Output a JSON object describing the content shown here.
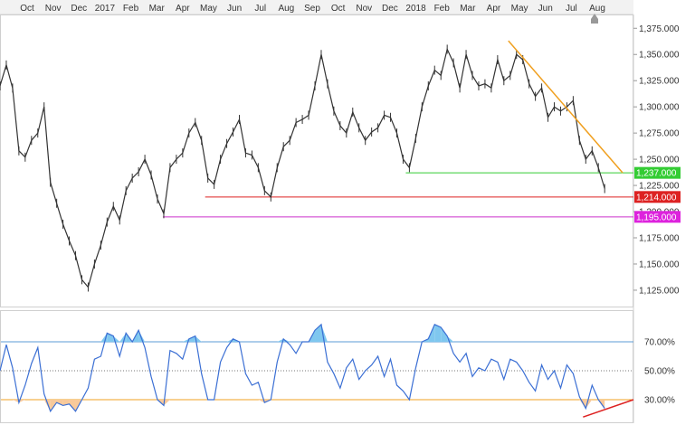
{
  "chart_data": [
    {
      "type": "line",
      "title": "",
      "xlabel": "",
      "ylabel": "",
      "x_ticks": [
        "Oct",
        "Nov",
        "Dec",
        "2017",
        "Feb",
        "Mar",
        "Apr",
        "May",
        "Jun",
        "Jul",
        "Aug",
        "Sep",
        "Oct",
        "Nov",
        "Dec",
        "2018",
        "Feb",
        "Mar",
        "Apr",
        "May",
        "Jun",
        "Jul",
        "Aug"
      ],
      "y_ticks": [
        "1,375.000",
        "1,350.000",
        "1,325.000",
        "1,300.000",
        "1,275.000",
        "1,250.000",
        "1,225.000",
        "1,200.000",
        "1,175.000",
        "1,150.000",
        "1,125.000"
      ],
      "y_tick_values": [
        1375,
        1350,
        1325,
        1300,
        1275,
        1250,
        1225,
        1200,
        1175,
        1150,
        1125
      ],
      "ylim": [
        1112,
        1383
      ],
      "grid": false,
      "x_range": [
        "2016-09-15",
        "2018-08-20"
      ],
      "series": [
        {
          "color": "#333333",
          "points": [
            [
              "2016-09-15",
              1320
            ],
            [
              "2016-09-22",
              1340
            ],
            [
              "2016-09-29",
              1318
            ],
            [
              "2016-10-06",
              1258
            ],
            [
              "2016-10-13",
              1252
            ],
            [
              "2016-10-20",
              1268
            ],
            [
              "2016-10-27",
              1275
            ],
            [
              "2016-11-03",
              1300
            ],
            [
              "2016-11-10",
              1228
            ],
            [
              "2016-11-17",
              1208
            ],
            [
              "2016-11-24",
              1188
            ],
            [
              "2016-12-01",
              1172
            ],
            [
              "2016-12-08",
              1158
            ],
            [
              "2016-12-15",
              1135
            ],
            [
              "2016-12-22",
              1128
            ],
            [
              "2016-12-29",
              1150
            ],
            [
              "2017-01-05",
              1168
            ],
            [
              "2017-01-12",
              1190
            ],
            [
              "2017-01-19",
              1205
            ],
            [
              "2017-01-26",
              1192
            ],
            [
              "2017-02-02",
              1220
            ],
            [
              "2017-02-09",
              1232
            ],
            [
              "2017-02-16",
              1238
            ],
            [
              "2017-02-23",
              1250
            ],
            [
              "2017-03-02",
              1235
            ],
            [
              "2017-03-09",
              1212
            ],
            [
              "2017-03-16",
              1198
            ],
            [
              "2017-03-23",
              1242
            ],
            [
              "2017-03-30",
              1250
            ],
            [
              "2017-04-06",
              1256
            ],
            [
              "2017-04-13",
              1275
            ],
            [
              "2017-04-20",
              1285
            ],
            [
              "2017-04-27",
              1268
            ],
            [
              "2017-05-04",
              1232
            ],
            [
              "2017-05-11",
              1226
            ],
            [
              "2017-05-18",
              1250
            ],
            [
              "2017-05-25",
              1265
            ],
            [
              "2017-06-01",
              1276
            ],
            [
              "2017-06-08",
              1288
            ],
            [
              "2017-06-15",
              1256
            ],
            [
              "2017-06-22",
              1254
            ],
            [
              "2017-06-29",
              1242
            ],
            [
              "2017-07-06",
              1220
            ],
            [
              "2017-07-13",
              1214
            ],
            [
              "2017-07-20",
              1242
            ],
            [
              "2017-07-27",
              1262
            ],
            [
              "2017-08-03",
              1268
            ],
            [
              "2017-08-10",
              1285
            ],
            [
              "2017-08-17",
              1288
            ],
            [
              "2017-08-24",
              1292
            ],
            [
              "2017-08-31",
              1320
            ],
            [
              "2017-09-07",
              1350
            ],
            [
              "2017-09-14",
              1322
            ],
            [
              "2017-09-21",
              1296
            ],
            [
              "2017-09-28",
              1282
            ],
            [
              "2017-10-05",
              1275
            ],
            [
              "2017-10-12",
              1295
            ],
            [
              "2017-10-19",
              1280
            ],
            [
              "2017-10-26",
              1268
            ],
            [
              "2017-11-02",
              1276
            ],
            [
              "2017-11-09",
              1280
            ],
            [
              "2017-11-16",
              1292
            ],
            [
              "2017-11-23",
              1290
            ],
            [
              "2017-11-30",
              1275
            ],
            [
              "2017-12-07",
              1250
            ],
            [
              "2017-12-14",
              1242
            ],
            [
              "2017-12-21",
              1270
            ],
            [
              "2017-12-28",
              1300
            ],
            [
              "2018-01-04",
              1320
            ],
            [
              "2018-01-11",
              1335
            ],
            [
              "2018-01-18",
              1330
            ],
            [
              "2018-01-25",
              1355
            ],
            [
              "2018-02-01",
              1342
            ],
            [
              "2018-02-08",
              1318
            ],
            [
              "2018-02-15",
              1350
            ],
            [
              "2018-02-22",
              1330
            ],
            [
              "2018-03-01",
              1320
            ],
            [
              "2018-03-08",
              1322
            ],
            [
              "2018-03-15",
              1318
            ],
            [
              "2018-03-22",
              1345
            ],
            [
              "2018-03-29",
              1325
            ],
            [
              "2018-04-05",
              1330
            ],
            [
              "2018-04-12",
              1350
            ],
            [
              "2018-04-19",
              1345
            ],
            [
              "2018-04-26",
              1322
            ],
            [
              "2018-05-03",
              1310
            ],
            [
              "2018-05-10",
              1318
            ],
            [
              "2018-05-17",
              1290
            ],
            [
              "2018-05-24",
              1300
            ],
            [
              "2018-05-31",
              1296
            ],
            [
              "2018-06-07",
              1300
            ],
            [
              "2018-06-14",
              1306
            ],
            [
              "2018-06-21",
              1268
            ],
            [
              "2018-06-28",
              1250
            ],
            [
              "2018-07-05",
              1258
            ],
            [
              "2018-07-12",
              1242
            ],
            [
              "2018-07-19",
              1222
            ]
          ]
        }
      ],
      "reference_lines": [
        {
          "label": "1,237.000",
          "value": 1237,
          "from": "2017-12-10",
          "color": "#33cc33"
        },
        {
          "label": "1,214.000",
          "value": 1214,
          "from": "2017-05-01",
          "color": "#dd2222"
        },
        {
          "label": "1,195.000",
          "value": 1195,
          "from": "2017-03-15",
          "color": "#cc33cc"
        }
      ],
      "trendline": {
        "from": [
          "2018-04-03",
          1363
        ],
        "to": [
          "2018-08-08",
          1237
        ],
        "color": "#f0a020"
      },
      "annotations": [
        {
          "label": "1,237.000",
          "value": 1237,
          "color": "#33cc33"
        },
        {
          "label": "1,214.000",
          "value": 1214,
          "color": "#dd2222"
        },
        {
          "label": "1,195.000",
          "value": 1195,
          "color": "#dd22dd"
        }
      ]
    },
    {
      "type": "line",
      "title": "",
      "xlabel": "",
      "ylabel": "",
      "y_ticks": [
        "70.00%",
        "50.00%",
        "30.00%"
      ],
      "y_tick_values": [
        70,
        50,
        30
      ],
      "ylim": [
        15,
        90
      ],
      "grid": false,
      "x_range": [
        "2016-09-15",
        "2018-08-20"
      ],
      "levels": [
        {
          "value": 70,
          "color": "#5b9bd5",
          "style": "solid"
        },
        {
          "value": 50,
          "color": "#777777",
          "style": "dotted"
        },
        {
          "value": 30,
          "color": "#f0a020",
          "style": "solid"
        }
      ],
      "fills": {
        "overbought": "#7fc7ef",
        "oversold": "#f8c99a"
      },
      "series": [
        {
          "color": "#3b6fd4",
          "points": [
            [
              "2016-09-15",
              50
            ],
            [
              "2016-09-22",
              68
            ],
            [
              "2016-09-29",
              52
            ],
            [
              "2016-10-06",
              28
            ],
            [
              "2016-10-13",
              40
            ],
            [
              "2016-10-20",
              55
            ],
            [
              "2016-10-27",
              66
            ],
            [
              "2016-11-03",
              34
            ],
            [
              "2016-11-10",
              22
            ],
            [
              "2016-11-17",
              28
            ],
            [
              "2016-11-24",
              26
            ],
            [
              "2016-12-01",
              27
            ],
            [
              "2016-12-08",
              22
            ],
            [
              "2016-12-15",
              30
            ],
            [
              "2016-12-22",
              38
            ],
            [
              "2016-12-29",
              58
            ],
            [
              "2017-01-05",
              60
            ],
            [
              "2017-01-12",
              76
            ],
            [
              "2017-01-19",
              74
            ],
            [
              "2017-01-26",
              60
            ],
            [
              "2017-02-02",
              76
            ],
            [
              "2017-02-09",
              70
            ],
            [
              "2017-02-16",
              78
            ],
            [
              "2017-02-23",
              66
            ],
            [
              "2017-03-02",
              46
            ],
            [
              "2017-03-09",
              30
            ],
            [
              "2017-03-16",
              26
            ],
            [
              "2017-03-23",
              64
            ],
            [
              "2017-03-30",
              62
            ],
            [
              "2017-04-06",
              58
            ],
            [
              "2017-04-13",
              72
            ],
            [
              "2017-04-20",
              74
            ],
            [
              "2017-04-27",
              48
            ],
            [
              "2017-05-04",
              30
            ],
            [
              "2017-05-11",
              30
            ],
            [
              "2017-05-18",
              56
            ],
            [
              "2017-05-25",
              66
            ],
            [
              "2017-06-01",
              72
            ],
            [
              "2017-06-08",
              70
            ],
            [
              "2017-06-15",
              48
            ],
            [
              "2017-06-22",
              40
            ],
            [
              "2017-06-29",
              42
            ],
            [
              "2017-07-06",
              28
            ],
            [
              "2017-07-13",
              30
            ],
            [
              "2017-07-20",
              56
            ],
            [
              "2017-07-27",
              72
            ],
            [
              "2017-08-03",
              68
            ],
            [
              "2017-08-10",
              62
            ],
            [
              "2017-08-17",
              70
            ],
            [
              "2017-08-24",
              70
            ],
            [
              "2017-08-31",
              78
            ],
            [
              "2017-09-07",
              82
            ],
            [
              "2017-09-14",
              56
            ],
            [
              "2017-09-21",
              48
            ],
            [
              "2017-09-28",
              38
            ],
            [
              "2017-10-05",
              52
            ],
            [
              "2017-10-12",
              58
            ],
            [
              "2017-10-19",
              44
            ],
            [
              "2017-10-26",
              50
            ],
            [
              "2017-11-02",
              54
            ],
            [
              "2017-11-09",
              60
            ],
            [
              "2017-11-16",
              46
            ],
            [
              "2017-11-23",
              58
            ],
            [
              "2017-11-30",
              40
            ],
            [
              "2017-12-07",
              36
            ],
            [
              "2017-12-14",
              30
            ],
            [
              "2017-12-21",
              52
            ],
            [
              "2017-12-28",
              70
            ],
            [
              "2018-01-04",
              72
            ],
            [
              "2018-01-11",
              82
            ],
            [
              "2018-01-18",
              80
            ],
            [
              "2018-01-25",
              74
            ],
            [
              "2018-02-01",
              62
            ],
            [
              "2018-02-08",
              56
            ],
            [
              "2018-02-15",
              62
            ],
            [
              "2018-02-22",
              46
            ],
            [
              "2018-03-01",
              52
            ],
            [
              "2018-03-08",
              50
            ],
            [
              "2018-03-15",
              58
            ],
            [
              "2018-03-22",
              56
            ],
            [
              "2018-03-29",
              44
            ],
            [
              "2018-04-05",
              58
            ],
            [
              "2018-04-12",
              56
            ],
            [
              "2018-04-19",
              50
            ],
            [
              "2018-04-26",
              42
            ],
            [
              "2018-05-03",
              36
            ],
            [
              "2018-05-10",
              54
            ],
            [
              "2018-05-17",
              44
            ],
            [
              "2018-05-24",
              50
            ],
            [
              "2018-05-31",
              38
            ],
            [
              "2018-06-07",
              54
            ],
            [
              "2018-06-14",
              48
            ],
            [
              "2018-06-21",
              32
            ],
            [
              "2018-06-28",
              24
            ],
            [
              "2018-07-05",
              40
            ],
            [
              "2018-07-12",
              30
            ],
            [
              "2018-07-19",
              24
            ]
          ]
        }
      ],
      "trendline": {
        "from": [
          "2018-06-25",
          18
        ],
        "to": [
          "2018-08-20",
          30
        ],
        "color": "#dd2222"
      }
    }
  ]
}
